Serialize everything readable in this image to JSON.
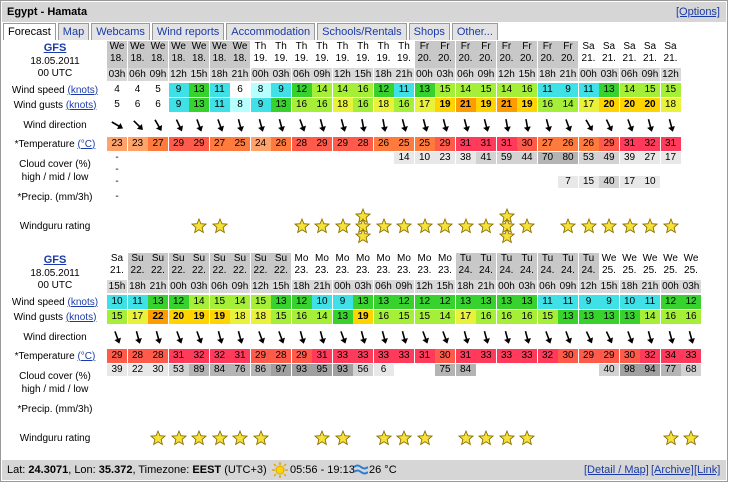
{
  "title": "Egypt - Hamata",
  "options_link": "[Options]",
  "tabs": [
    "Forecast",
    "Map",
    "Webcams",
    "Wind reports",
    "Accommodation",
    "Schools/Rentals",
    "Shops",
    "Other..."
  ],
  "labels": {
    "model": "GFS",
    "date": "18.05.2011",
    "utc": "00 UTC",
    "wind_speed": "Wind speed",
    "wind_gusts": "Wind gusts",
    "knots": "(knots)",
    "wind_direction": "Wind direction",
    "temperature": "*Temperature",
    "celsius": "(°C)",
    "cloud1": "Cloud cover (%)",
    "cloud2": "high / mid / low",
    "precip": "*Precip. (mm/3h)",
    "rating": "Windguru rating"
  },
  "colors": {
    "shade_weekend": "#c8c8c8",
    "hour_bg": "#d8d8d8"
  },
  "blocks": [
    {
      "days": [
        [
          "We",
          "18."
        ],
        [
          "We",
          "18."
        ],
        [
          "We",
          "18."
        ],
        [
          "We",
          "18."
        ],
        [
          "We",
          "18."
        ],
        [
          "We",
          "18."
        ],
        [
          "We",
          "18."
        ],
        [
          "Th",
          "19."
        ],
        [
          "Th",
          "19."
        ],
        [
          "Th",
          "19."
        ],
        [
          "Th",
          "19."
        ],
        [
          "Th",
          "19."
        ],
        [
          "Th",
          "19."
        ],
        [
          "Th",
          "19."
        ],
        [
          "Th",
          "19."
        ],
        [
          "Fr",
          "20."
        ],
        [
          "Fr",
          "20."
        ],
        [
          "Fr",
          "20."
        ],
        [
          "Fr",
          "20."
        ],
        [
          "Fr",
          "20."
        ],
        [
          "Fr",
          "20."
        ],
        [
          "Fr",
          "20."
        ],
        [
          "Fr",
          "20."
        ],
        [
          "Sa",
          "21."
        ],
        [
          "Sa",
          "21."
        ],
        [
          "Sa",
          "21."
        ],
        [
          "Sa",
          "21."
        ],
        [
          "Sa",
          "21."
        ]
      ],
      "shaded": [
        true,
        true,
        true,
        true,
        true,
        true,
        true,
        false,
        false,
        false,
        false,
        false,
        false,
        false,
        false,
        true,
        true,
        true,
        true,
        true,
        true,
        true,
        true,
        false,
        false,
        false,
        false,
        false
      ],
      "hours": [
        "03h",
        "06h",
        "09h",
        "12h",
        "15h",
        "18h",
        "21h",
        "00h",
        "03h",
        "06h",
        "09h",
        "12h",
        "15h",
        "18h",
        "21h",
        "00h",
        "03h",
        "06h",
        "09h",
        "12h",
        "15h",
        "18h",
        "21h",
        "00h",
        "03h",
        "06h",
        "09h",
        "12h"
      ],
      "speed": [
        4,
        4,
        5,
        9,
        13,
        11,
        6,
        8,
        9,
        12,
        14,
        14,
        16,
        12,
        11,
        13,
        15,
        14,
        15,
        14,
        16,
        11,
        9,
        11,
        13,
        14,
        15,
        15
      ],
      "gusts": [
        5,
        6,
        6,
        9,
        13,
        11,
        8,
        9,
        13,
        16,
        16,
        18,
        16,
        18,
        16,
        17,
        19,
        21,
        19,
        21,
        19,
        16,
        14,
        17,
        20,
        20,
        20,
        18
      ],
      "direction": [
        120,
        135,
        150,
        155,
        160,
        160,
        165,
        165,
        165,
        160,
        165,
        165,
        170,
        170,
        165,
        165,
        165,
        165,
        165,
        170,
        170,
        165,
        160,
        150,
        155,
        160,
        165,
        165
      ],
      "temp": [
        23,
        23,
        27,
        29,
        29,
        27,
        25,
        24,
        26,
        28,
        29,
        29,
        28,
        26,
        25,
        25,
        29,
        31,
        31,
        31,
        30,
        27,
        26,
        26,
        29,
        31,
        32,
        31
      ],
      "cloud_high": [
        "-",
        "",
        "",
        "",
        "",
        "",
        "",
        "",
        "",
        "",
        "",
        "",
        "",
        "",
        "14",
        "10",
        "23",
        "38",
        "41",
        "59",
        "44",
        "70",
        "80",
        "53",
        "49",
        "39",
        "27",
        "17"
      ],
      "cloud_mid": [
        "-",
        "",
        "",
        "",
        "",
        "",
        "",
        "",
        "",
        "",
        "",
        "",
        "",
        "",
        "",
        "",
        "",
        "",
        "",
        "",
        "",
        "",
        "",
        "",
        "",
        "",
        "",
        ""
      ],
      "cloud_low": [
        "-",
        "",
        "",
        "",
        "",
        "",
        "",
        "",
        "",
        "",
        "",
        "",
        "",
        "",
        "",
        "",
        "",
        "",
        "",
        "",
        "",
        "",
        "7",
        "15",
        "40",
        "17",
        "10",
        ""
      ],
      "precip": [
        "-",
        "",
        "",
        "",
        "",
        "",
        "",
        "",
        "",
        "",
        "",
        "",
        "",
        "",
        "",
        "",
        "",
        "",
        "",
        "",
        "",
        "",
        "",
        "",
        "",
        "",
        "",
        ""
      ],
      "stars": [
        0,
        0,
        0,
        0,
        1,
        1,
        0,
        0,
        0,
        1,
        1,
        1,
        3,
        1,
        1,
        1,
        1,
        1,
        1,
        3,
        1,
        0,
        1,
        1,
        1,
        1,
        1,
        1
      ]
    },
    {
      "days": [
        [
          "Sa",
          "21."
        ],
        [
          "Su",
          "22."
        ],
        [
          "Su",
          "22."
        ],
        [
          "Su",
          "22."
        ],
        [
          "Su",
          "22."
        ],
        [
          "Su",
          "22."
        ],
        [
          "Su",
          "22."
        ],
        [
          "Su",
          "22."
        ],
        [
          "Su",
          "22."
        ],
        [
          "Mo",
          "23."
        ],
        [
          "Mo",
          "23."
        ],
        [
          "Mo",
          "23."
        ],
        [
          "Mo",
          "23."
        ],
        [
          "Mo",
          "23."
        ],
        [
          "Mo",
          "23."
        ],
        [
          "Mo",
          "23."
        ],
        [
          "Mo",
          "23."
        ],
        [
          "Tu",
          "24."
        ],
        [
          "Tu",
          "24."
        ],
        [
          "Tu",
          "24."
        ],
        [
          "Tu",
          "24."
        ],
        [
          "Tu",
          "24."
        ],
        [
          "Tu",
          "24."
        ],
        [
          "Tu",
          "24."
        ],
        [
          "We",
          "25."
        ],
        [
          "We",
          "25."
        ],
        [
          "We",
          "25."
        ],
        [
          "We",
          "25."
        ],
        [
          "We",
          "25."
        ]
      ],
      "shaded": [
        false,
        true,
        true,
        true,
        true,
        true,
        true,
        true,
        true,
        false,
        false,
        false,
        false,
        false,
        false,
        false,
        false,
        true,
        true,
        true,
        true,
        true,
        true,
        true,
        false,
        false,
        false,
        false,
        false
      ],
      "hours": [
        "15h",
        "18h",
        "21h",
        "00h",
        "03h",
        "06h",
        "09h",
        "12h",
        "15h",
        "18h",
        "21h",
        "00h",
        "03h",
        "06h",
        "09h",
        "12h",
        "15h",
        "18h",
        "21h",
        "00h",
        "03h",
        "06h",
        "09h",
        "12h",
        "15h",
        "18h",
        "21h",
        "00h",
        "03h"
      ],
      "speed": [
        10,
        11,
        13,
        12,
        14,
        15,
        14,
        15,
        13,
        12,
        10,
        9,
        13,
        13,
        12,
        12,
        12,
        13,
        13,
        13,
        13,
        11,
        11,
        9,
        9,
        10,
        11,
        12,
        12
      ],
      "gusts": [
        15,
        17,
        22,
        20,
        19,
        19,
        18,
        18,
        15,
        16,
        14,
        13,
        19,
        16,
        15,
        15,
        14,
        17,
        16,
        16,
        16,
        15,
        13,
        13,
        13,
        13,
        14,
        16,
        16
      ],
      "direction": [
        160,
        165,
        165,
        160,
        160,
        165,
        165,
        160,
        160,
        165,
        165,
        160,
        165,
        165,
        165,
        160,
        160,
        165,
        165,
        165,
        165,
        160,
        160,
        155,
        155,
        160,
        165,
        165,
        165
      ],
      "temp": [
        29,
        28,
        28,
        31,
        32,
        32,
        31,
        29,
        28,
        29,
        31,
        33,
        33,
        33,
        33,
        31,
        30,
        31,
        33,
        33,
        33,
        32,
        30,
        29,
        29,
        30,
        32,
        34,
        33
      ],
      "cloud_high": [
        "39",
        "22",
        "30",
        "53",
        "89",
        "84",
        "76",
        "86",
        "97",
        "93",
        "95",
        "93",
        "56",
        "6",
        "",
        "",
        "75",
        "84",
        "",
        "",
        "",
        "",
        "",
        "",
        "40",
        "98",
        "94",
        "77",
        "68"
      ],
      "cloud_mid": [
        "",
        "",
        "",
        "",
        "",
        "",
        "",
        "",
        "",
        "",
        "",
        "",
        "",
        "",
        "",
        "",
        "",
        "",
        "",
        "",
        "",
        "",
        "",
        "",
        "",
        "",
        "",
        "",
        ""
      ],
      "cloud_low": [
        "",
        "",
        "",
        "",
        "",
        "",
        "",
        "",
        "",
        "",
        "",
        "",
        "",
        "",
        "",
        "",
        "",
        "",
        "",
        "",
        "",
        "",
        "",
        "",
        "",
        "",
        "",
        "",
        ""
      ],
      "precip": [
        "",
        "",
        "",
        "",
        "",
        "",
        "",
        "",
        "",
        "",
        "",
        "",
        "",
        "",
        "",
        "",
        "",
        "",
        "",
        "",
        "",
        "",
        "",
        "",
        "",
        "",
        "",
        "",
        ""
      ],
      "stars": [
        0,
        0,
        1,
        1,
        1,
        1,
        1,
        1,
        0,
        0,
        1,
        1,
        0,
        1,
        1,
        1,
        0,
        1,
        1,
        1,
        1,
        0,
        0,
        0,
        0,
        0,
        0,
        1,
        1
      ]
    }
  ],
  "footer": {
    "lat_label": "Lat:",
    "lat": "24.3071",
    "lon_label": "Lon:",
    "lon": "35.372",
    "tz_label": "Timezone:",
    "tz": "EEST",
    "tz_offset": "(UTC+3)",
    "sun": "05:56 - 19:13",
    "water_temp": "26 °C",
    "links": [
      "[Detail / Map]",
      "[Archive]",
      "[Link]"
    ]
  }
}
